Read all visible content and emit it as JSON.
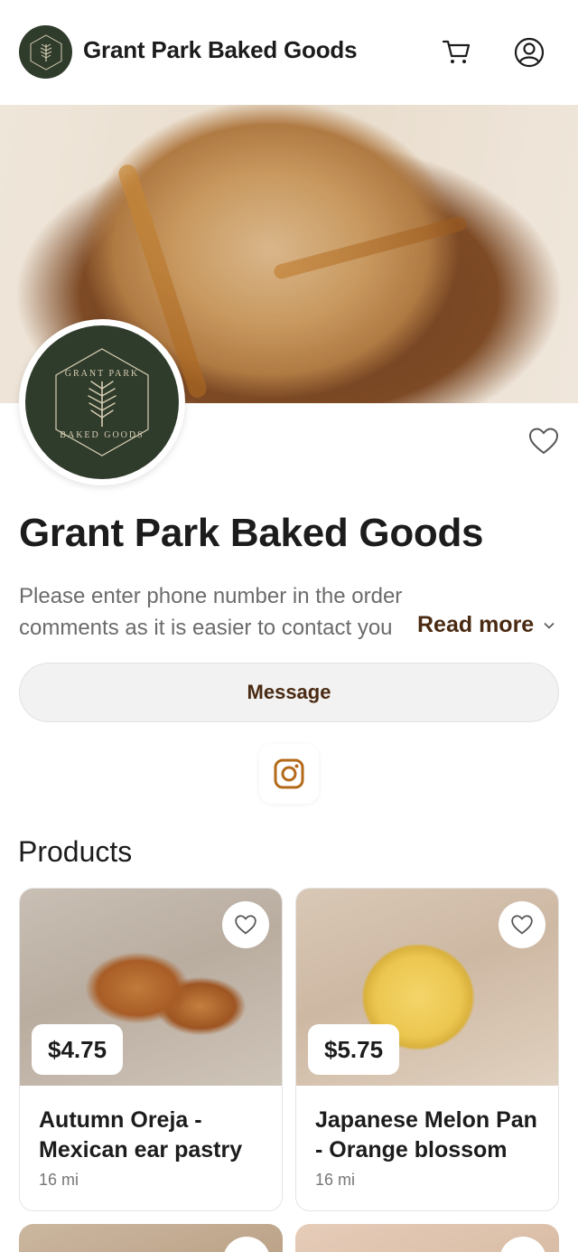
{
  "header": {
    "title": "Grant Park Baked Goods",
    "logo_icon": "grant-park-logo",
    "cart_icon": "cart-icon",
    "account_icon": "user-circle-icon"
  },
  "profile": {
    "name": "Grant Park Baked Goods",
    "description_line1": "Please enter phone number in the order",
    "description_line2": "comments as it is easier to contact you",
    "read_more_label": "Read more",
    "message_label": "Message",
    "social_icon": "instagram-icon",
    "logo_text_top": "GRANT PARK",
    "logo_text_bottom": "BAKED GOODS"
  },
  "products": {
    "title": "Products",
    "items": [
      {
        "name": "Autumn Oreja - Mexican ear pastry",
        "price": "$4.75",
        "distance": "16 mi"
      },
      {
        "name": "Japanese Melon Pan - Orange blossom",
        "price": "$5.75",
        "distance": "16 mi"
      }
    ]
  },
  "colors": {
    "brand_green": "#2f3b2b",
    "accent_brown": "#4a2a12",
    "instagram_orange": "#b36a1a"
  }
}
